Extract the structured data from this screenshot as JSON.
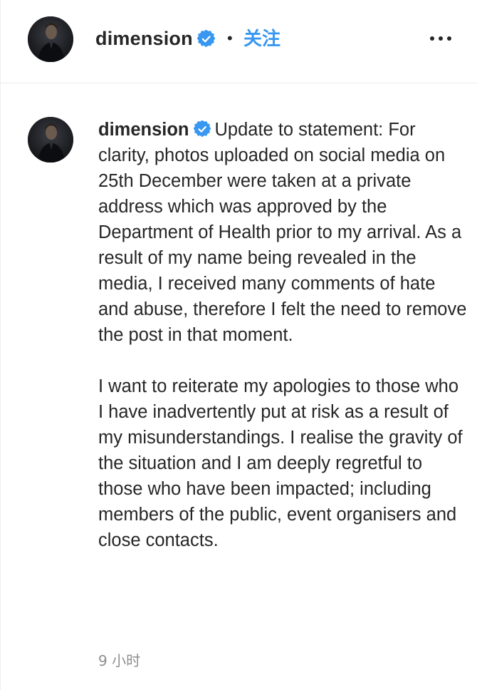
{
  "header": {
    "username": "dimension",
    "separator": "•",
    "follow_label": "关注",
    "more_icon": "more-horizontal-icon"
  },
  "post": {
    "username": "dimension",
    "verified_icon": "verified-badge-icon",
    "paragraphs": [
      "Update to statement: For clarity, photos uploaded on social media on 25th December were taken at a private address which was approved by the Department of Health prior to my arrival. As a result of my name being revealed in the media, I received many comments of hate and abuse, therefore I felt the need to remove the post in that moment.",
      "I want to reiterate my apologies to those who I have inadvertently put at risk as a result of my misunderstandings. I realise the gravity of the situation and I am deeply regretful to those who have been impacted; including members of the public, event organisers and close contacts."
    ],
    "timestamp": "9 小时"
  },
  "colors": {
    "accent": "#3897f0",
    "verified": "#3897f0",
    "text": "#262626",
    "muted": "#8e8e8e",
    "divider": "#ececec"
  }
}
